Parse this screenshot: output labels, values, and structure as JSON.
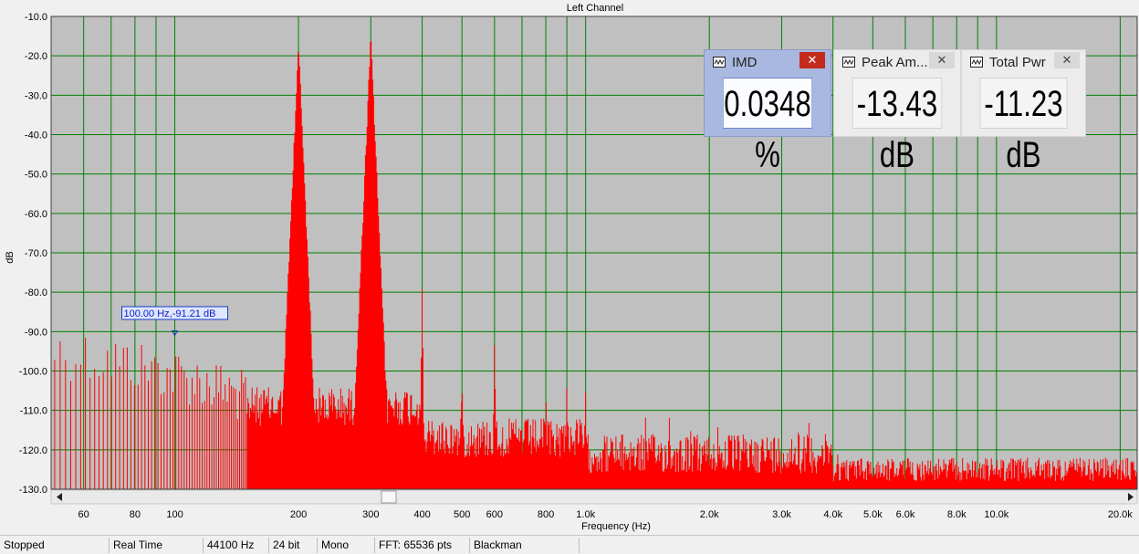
{
  "chart_data": {
    "type": "spectrum",
    "title": "Left Channel",
    "xlabel": "Frequency (Hz)",
    "ylabel": "dB",
    "xscale": "log",
    "xlim": [
      50,
      22000
    ],
    "ylim": [
      -130,
      -10
    ],
    "yticks": [
      "-10.0",
      "-20.0",
      "-30.0",
      "-40.0",
      "-50.0",
      "-60.0",
      "-70.0",
      "-80.0",
      "-90.0",
      "-100.0",
      "-110.0",
      "-120.0",
      "-130.0"
    ],
    "xtick_labels": [
      {
        "f": 60,
        "label": "60"
      },
      {
        "f": 80,
        "label": "80"
      },
      {
        "f": 100,
        "label": "100"
      },
      {
        "f": 200,
        "label": "200"
      },
      {
        "f": 300,
        "label": "300"
      },
      {
        "f": 400,
        "label": "400"
      },
      {
        "f": 500,
        "label": "500"
      },
      {
        "f": 600,
        "label": "600"
      },
      {
        "f": 800,
        "label": "800"
      },
      {
        "f": 1000,
        "label": "1.0k"
      },
      {
        "f": 2000,
        "label": "2.0k"
      },
      {
        "f": 3000,
        "label": "3.0k"
      },
      {
        "f": 4000,
        "label": "4.0k"
      },
      {
        "f": 5000,
        "label": "5.0k"
      },
      {
        "f": 6000,
        "label": "6.0k"
      },
      {
        "f": 8000,
        "label": "8.0k"
      },
      {
        "f": 10000,
        "label": "10.0k"
      },
      {
        "f": 20000,
        "label": "20.0k"
      }
    ],
    "gridlines_hz": [
      60,
      70,
      80,
      90,
      100,
      200,
      300,
      400,
      500,
      600,
      700,
      800,
      900,
      1000,
      2000,
      3000,
      4000,
      5000,
      6000,
      7000,
      8000,
      9000,
      10000,
      20000
    ],
    "grid": true,
    "colors": {
      "plot_bg": "#c0c0c0",
      "grid": "#008000",
      "trace": "#ff0000"
    },
    "peaks": [
      {
        "f": 200,
        "db": -15
      },
      {
        "f": 300,
        "db": -13.5
      },
      {
        "f": 400,
        "db": -77
      },
      {
        "f": 500,
        "db": -95
      },
      {
        "f": 600,
        "db": -88
      },
      {
        "f": 800,
        "db": -100
      },
      {
        "f": 900,
        "db": -98
      },
      {
        "f": 1000,
        "db": -102
      },
      {
        "f": 1400,
        "db": -107
      },
      {
        "f": 1600,
        "db": -106
      },
      {
        "f": 1800,
        "db": -110
      },
      {
        "f": 2100,
        "db": -108
      },
      {
        "f": 2600,
        "db": -112
      },
      {
        "f": 3300,
        "db": -106
      },
      {
        "f": 3500,
        "db": -108
      },
      {
        "f": 4100,
        "db": -112
      },
      {
        "f": 4700,
        "db": -117
      },
      {
        "f": 5700,
        "db": -122
      }
    ],
    "noise_floor_db": -124,
    "marker": {
      "f": 100,
      "db": -91.21,
      "label": "100.00 Hz,-91.21 dB"
    }
  },
  "meters": [
    {
      "title": "IMD",
      "value": "0.0348 %",
      "active": true
    },
    {
      "title": "Peak Am...",
      "value": "-13.43 dB",
      "active": false
    },
    {
      "title": "Total Pwr",
      "value": "-11.23 dB",
      "active": false
    }
  ],
  "status_bar": [
    "Stopped",
    "Real Time",
    "44100 Hz",
    "24 bit",
    "Mono",
    "FFT: 65536 pts",
    "Blackman"
  ],
  "icons": {
    "meter": "waveform-icon",
    "close": "close-icon",
    "scroll_left": "arrow-left-icon",
    "scroll_right": "arrow-right-icon"
  }
}
